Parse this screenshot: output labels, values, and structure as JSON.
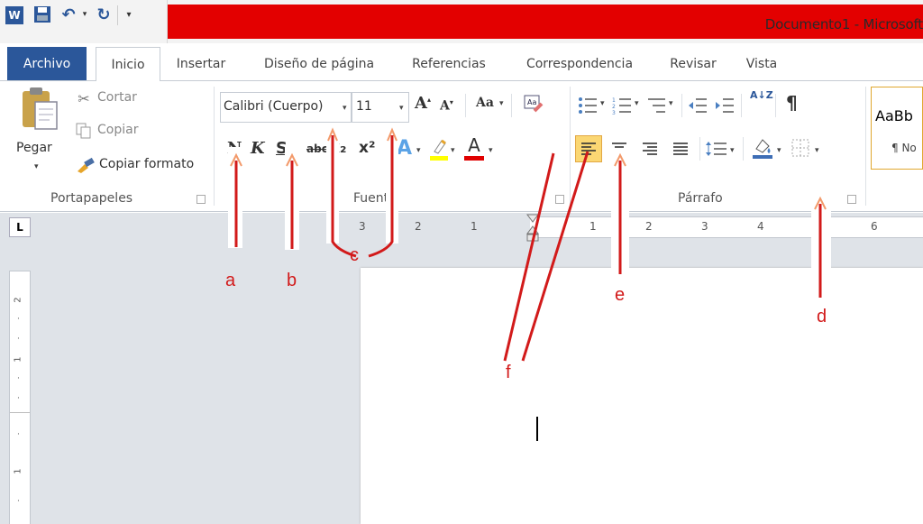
{
  "window": {
    "title": "Documento1 - Microsoft"
  },
  "tabs": [
    {
      "label": "Archivo"
    },
    {
      "label": "Inicio"
    },
    {
      "label": "Insertar"
    },
    {
      "label": "Diseño de página"
    },
    {
      "label": "Referencias"
    },
    {
      "label": "Correspondencia"
    },
    {
      "label": "Revisar"
    },
    {
      "label": "Vista"
    }
  ],
  "clipboard": {
    "paste_label": "Pegar",
    "cut_label": "Cortar",
    "copy_label": "Copiar",
    "format_painter_label": "Copiar formato",
    "group_label": "Portapapeles"
  },
  "font": {
    "font_name": "Calibri (Cuerpo)",
    "font_size": "11",
    "change_case_label": "Aa",
    "bold_label": "N",
    "italic_label": "K",
    "underline_label": "S",
    "strikethrough_label": "abc",
    "subscript_label": "x₂",
    "superscript_label": "x²",
    "group_label": "Fuente",
    "highlight_color": "#ffff00",
    "font_color": "#e00000"
  },
  "paragraph": {
    "sort_label": "A↓Z",
    "pilcrow_label": "¶",
    "group_label": "Párrafo"
  },
  "styles": {
    "style1_preview": "AaBb",
    "style1_name": "¶ No"
  },
  "ruler": {
    "ticks": [
      "3",
      "2",
      "1",
      "1",
      "2",
      "3",
      "4",
      "6"
    ]
  },
  "annotations": {
    "a": "a",
    "b": "b",
    "c": "c",
    "d": "d",
    "e": "e",
    "f": "f",
    "color": "#d21a1a",
    "arrow_color": "#f39a6b"
  }
}
